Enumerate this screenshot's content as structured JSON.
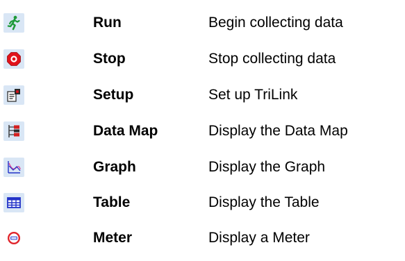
{
  "toolbar_legend": {
    "items": [
      {
        "icon": "run-icon",
        "name": "Run",
        "description": "Begin collecting data"
      },
      {
        "icon": "stop-icon",
        "name": "Stop",
        "description": "Stop collecting data"
      },
      {
        "icon": "setup-icon",
        "name": "Setup",
        "description": "Set up TriLink"
      },
      {
        "icon": "data-map-icon",
        "name": "Data Map",
        "description": "Display the Data Map"
      },
      {
        "icon": "graph-icon",
        "name": "Graph",
        "description": "Display the Graph"
      },
      {
        "icon": "table-icon",
        "name": "Table",
        "description": "Display the Table"
      },
      {
        "icon": "meter-icon",
        "name": "Meter",
        "description": "Display a Meter"
      }
    ]
  },
  "colors": {
    "icon_button_background": "#d9e6f5",
    "run_green": "#1f9a3a",
    "stop_red": "#e1121b",
    "graph_pink": "#d9479a",
    "table_blue": "#2232c8",
    "meter_red": "#e0242b"
  }
}
